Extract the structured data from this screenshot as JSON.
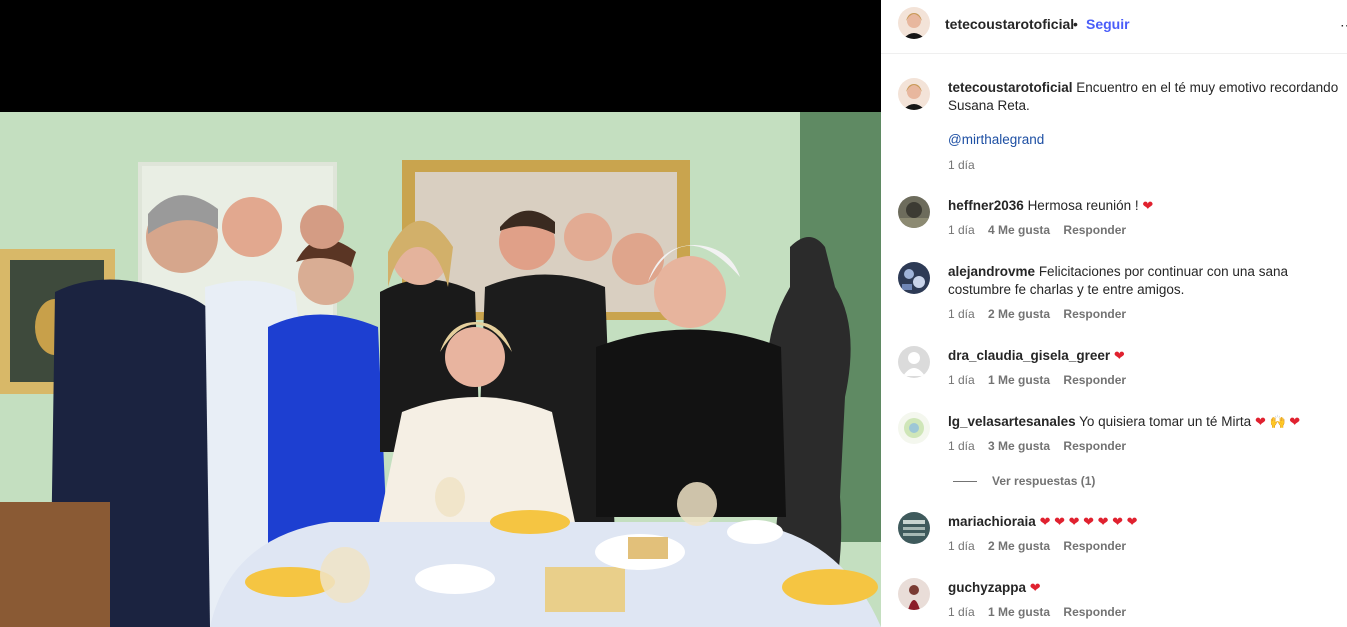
{
  "post": {
    "username": "tetecoustarotoficial",
    "separator": "•",
    "follow_label": "Seguir",
    "more_label": "⋯",
    "caption_text": "Encuentro en el té muy emotivo recordando Susana Reta.",
    "caption_mention": "@mirthalegrand",
    "caption_time": "1 día"
  },
  "comments": [
    {
      "username": "heffner2036",
      "text": "Hermosa reunión !",
      "emoji": "❤",
      "time": "1 día",
      "likes": "4 Me gusta",
      "reply": "Responder"
    },
    {
      "username": "alejandrovme",
      "text": "Felicitaciones por continuar con una sana costumbre fe charlas y te entre amigos.",
      "emoji": "",
      "time": "1 día",
      "likes": "2 Me gusta",
      "reply": "Responder"
    },
    {
      "username": "dra_claudia_gisela_greer",
      "text": "",
      "emoji": "❤",
      "time": "1 día",
      "likes": "1 Me gusta",
      "reply": "Responder"
    },
    {
      "username": "lg_velasartesanales",
      "text": "Yo quisiera tomar un té Mirta",
      "emoji": "❤ 🙌 ❤",
      "time": "1 día",
      "likes": "3 Me gusta",
      "reply": "Responder",
      "view_replies": "Ver respuestas (1)"
    },
    {
      "username": "mariachioraia",
      "text": "",
      "emoji": "❤ ❤ ❤ ❤ ❤ ❤ ❤",
      "time": "1 día",
      "likes": "2 Me gusta",
      "reply": "Responder"
    },
    {
      "username": "guchyzappa",
      "text": "",
      "emoji": "❤",
      "time": "1 día",
      "likes": "1 Me gusta",
      "reply": "Responder"
    }
  ],
  "colors": {
    "follow": "#4a5df9",
    "mention": "#1d4fa3",
    "heart": "#e0212f",
    "meta": "#737373"
  }
}
